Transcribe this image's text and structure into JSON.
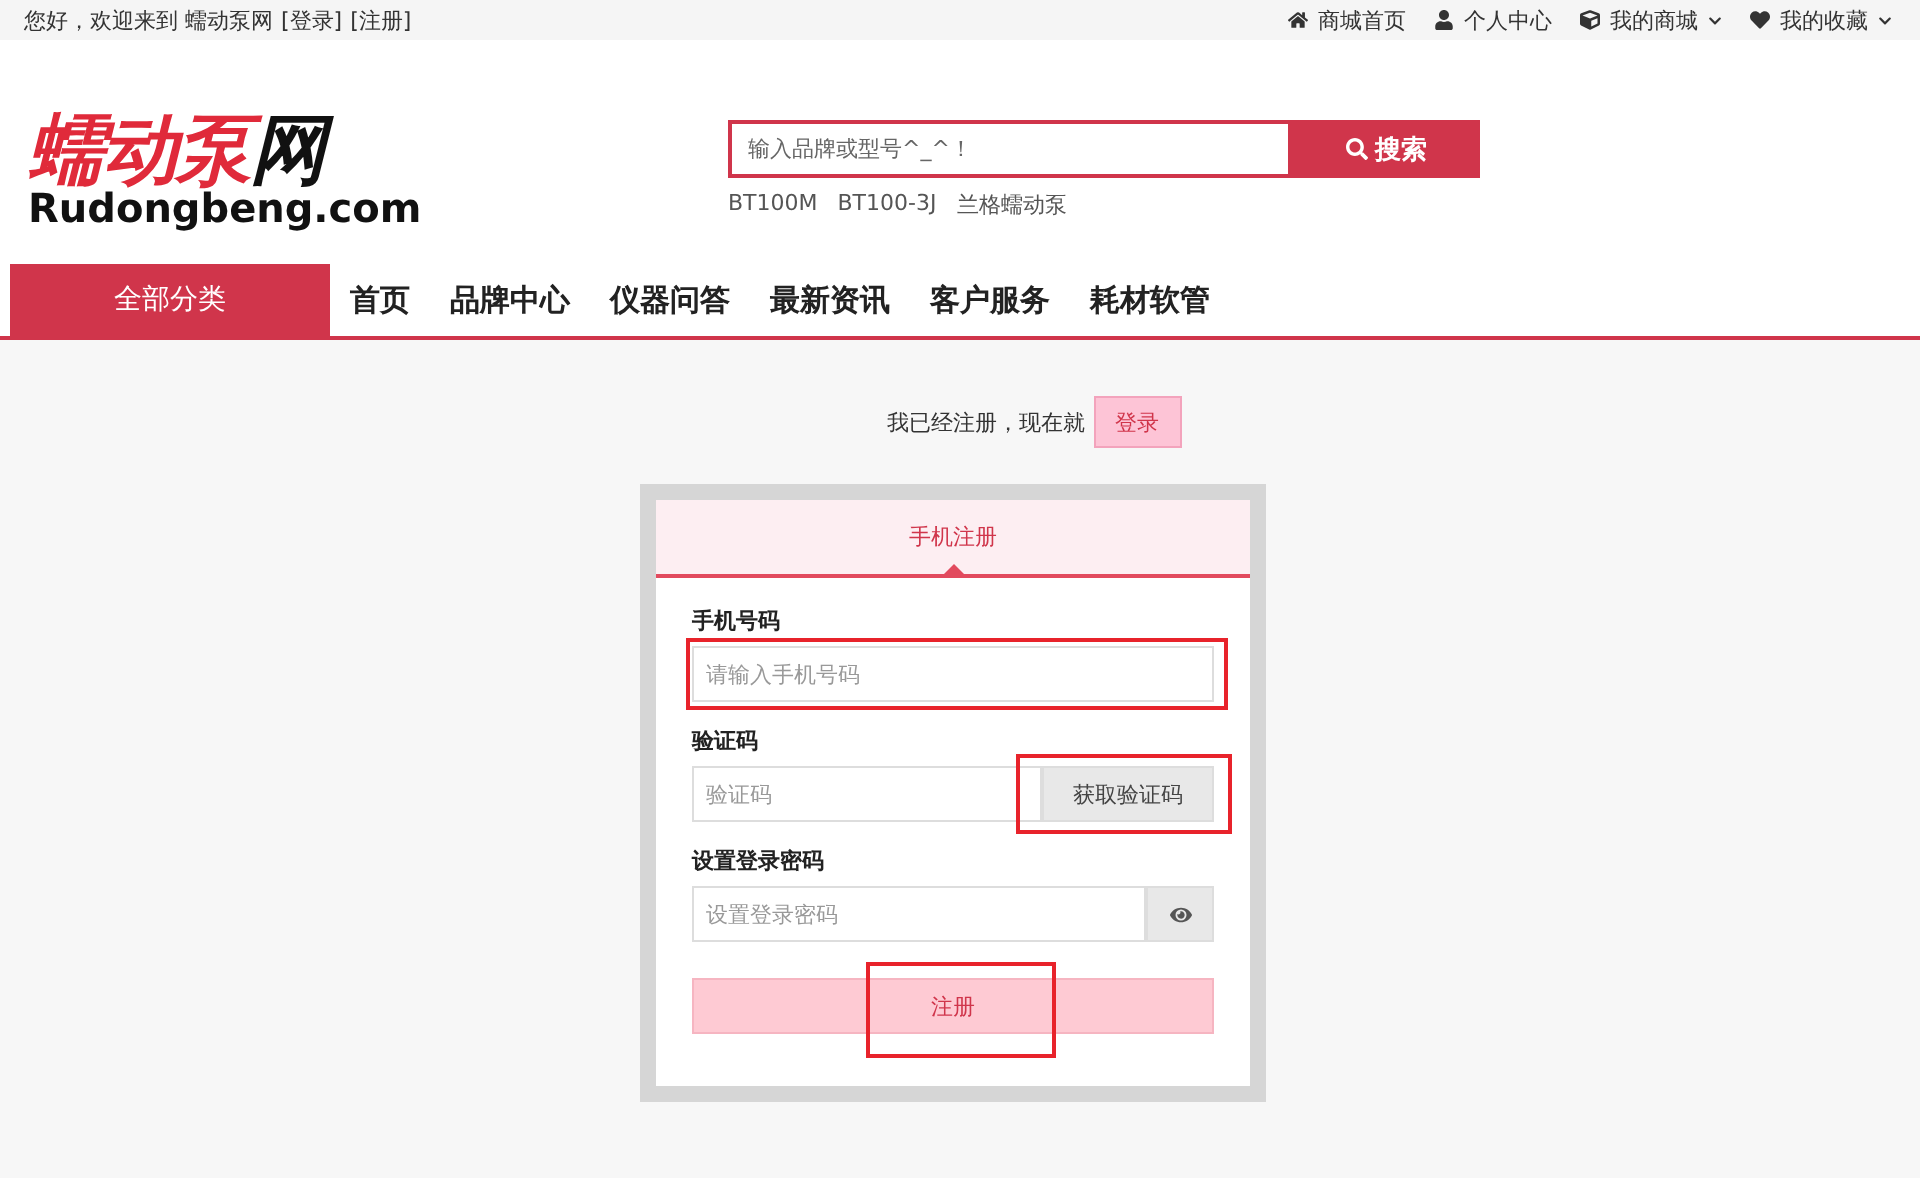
{
  "top_bar": {
    "greeting": "您好，欢迎来到 蠕动泵网",
    "links": [
      {
        "label": "[登录]"
      },
      {
        "label": "[注册]"
      }
    ],
    "right_links": [
      {
        "label": "商城首页",
        "dropdown": false
      },
      {
        "label": "个人中心",
        "dropdown": false
      },
      {
        "label": "我的商城",
        "dropdown": true
      },
      {
        "label": "我的收藏",
        "dropdown": true
      }
    ]
  },
  "logo": {
    "title_red": "蠕动泵",
    "title_dark": "网",
    "domain": "Rudongbeng.com"
  },
  "search": {
    "placeholder": "输入品牌或型号^_^！",
    "button": "搜索",
    "hot_words": [
      "BT100M",
      "BT100-3J",
      "兰格蠕动泵"
    ]
  },
  "nav": {
    "category": "全部分类",
    "items": [
      "首页",
      "品牌中心",
      "仪器问答",
      "最新资讯",
      "客户服务",
      "耗材软管"
    ]
  },
  "register": {
    "prompt": "我已经注册，现在就",
    "login_button": "登录",
    "tabs": [
      {
        "label": "手机注册",
        "selected": true
      }
    ],
    "fields": [
      {
        "kind": "text",
        "label": "手机号码",
        "placeholder": "请输入手机号码",
        "highlighted": true
      },
      {
        "kind": "code",
        "label": "验证码",
        "placeholder": "验证码",
        "button": "获取验证码",
        "highlighted": true
      },
      {
        "kind": "password",
        "label": "设置登录密码",
        "placeholder": "设置登录密码",
        "highlighted": false
      }
    ],
    "submit": {
      "label": "注册",
      "highlighted": true
    }
  }
}
